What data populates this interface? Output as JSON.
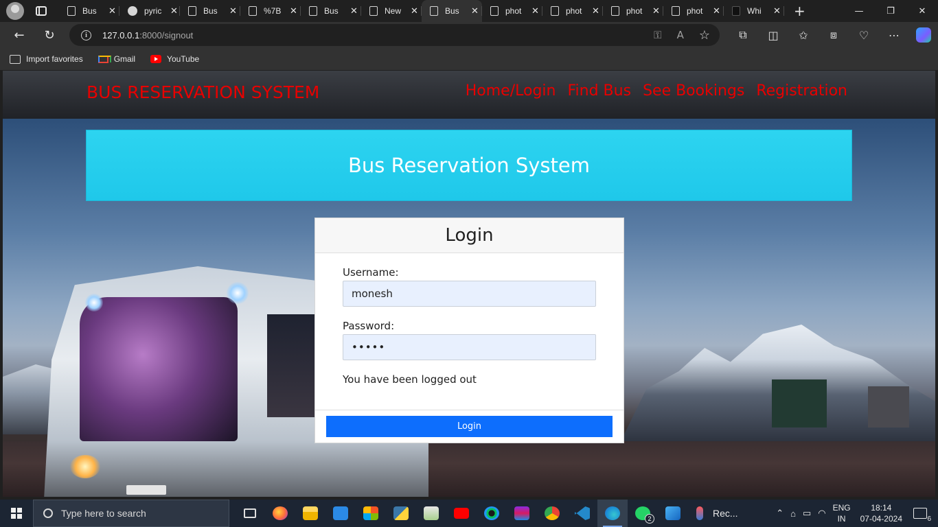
{
  "browser": {
    "tabs": [
      {
        "label": "Bus",
        "icon": "page-icon",
        "active": false
      },
      {
        "label": "pyric",
        "icon": "github-icon",
        "active": false
      },
      {
        "label": "Bus",
        "icon": "page-icon",
        "active": false
      },
      {
        "label": "%7B",
        "icon": "page-icon",
        "active": false
      },
      {
        "label": "Bus",
        "icon": "page-icon",
        "active": false
      },
      {
        "label": "New",
        "icon": "newtab-icon",
        "active": false
      },
      {
        "label": "Bus",
        "icon": "page-icon",
        "active": true
      },
      {
        "label": "phot",
        "icon": "page-icon",
        "active": false
      },
      {
        "label": "phot",
        "icon": "page-icon",
        "active": false
      },
      {
        "label": "phot",
        "icon": "page-icon",
        "active": false
      },
      {
        "label": "phot",
        "icon": "page-icon",
        "active": false
      },
      {
        "label": "Whi",
        "icon": "app-icon",
        "active": false
      }
    ],
    "url_host": "127.0.0.1",
    "url_rest": ":8000/signout",
    "favorites": [
      {
        "label": "Import favorites",
        "icon": "import-icon"
      },
      {
        "label": "Gmail",
        "icon": "gmail-icon"
      },
      {
        "label": "YouTube",
        "icon": "youtube-icon"
      }
    ]
  },
  "site": {
    "brand": "BUS RESERVATION SYSTEM",
    "nav": [
      "Home/Login",
      "Find Bus",
      "See Bookings",
      "Registration"
    ],
    "banner_title": "Bus Reservation System",
    "colors": {
      "brand": "#e80000",
      "banner": "#22cdec",
      "button": "#0d6efd"
    }
  },
  "login": {
    "title": "Login",
    "username_label": "Username:",
    "username_value": "monesh",
    "password_label": "Password:",
    "password_value": "•••••",
    "message": "You have been logged out",
    "button": "Login"
  },
  "taskbar": {
    "search_placeholder": "Type here to search",
    "rec_label": "Rec...",
    "whatsapp_badge": "2",
    "lang_line1": "ENG",
    "lang_line2": "IN",
    "time": "18:14",
    "date": "07-04-2024",
    "notification_count": "6"
  }
}
